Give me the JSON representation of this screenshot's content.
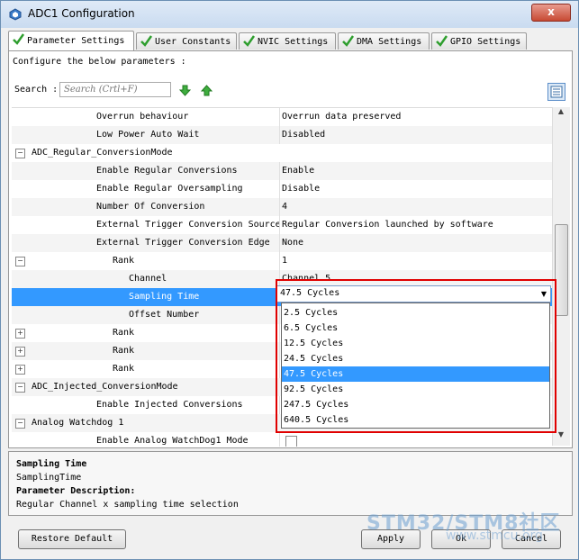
{
  "window": {
    "title": "ADC1 Configuration",
    "close_glyph": "x"
  },
  "tabs": [
    {
      "label": "Parameter Settings"
    },
    {
      "label": "User Constants"
    },
    {
      "label": "NVIC Settings"
    },
    {
      "label": "DMA Settings"
    },
    {
      "label": "GPIO Settings"
    }
  ],
  "toolbar": {
    "configure_text": "Configure the below parameters :",
    "search_label": "Search :",
    "search_placeholder": "Search (Crtl+F)"
  },
  "grid": {
    "rows": [
      {
        "key": "Overrun behaviour",
        "value": "Overrun data preserved"
      },
      {
        "key": "Low Power Auto Wait",
        "value": "Disabled"
      },
      {
        "key": "ADC_Regular_ConversionMode",
        "value": ""
      },
      {
        "key": "Enable Regular Conversions",
        "value": "Enable"
      },
      {
        "key": "Enable Regular Oversampling",
        "value": "Disable"
      },
      {
        "key": "Number Of Conversion",
        "value": "4"
      },
      {
        "key": "External Trigger Conversion Source",
        "value": "Regular Conversion launched by software"
      },
      {
        "key": "External Trigger Conversion Edge",
        "value": "None"
      },
      {
        "key": "Rank",
        "value": "1"
      },
      {
        "key": "Channel",
        "value": "Channel 5"
      },
      {
        "key": "Sampling Time",
        "value": "47.5 Cycles"
      },
      {
        "key": "Offset Number",
        "value": ""
      },
      {
        "key": "Rank",
        "value": ""
      },
      {
        "key": "Rank",
        "value": ""
      },
      {
        "key": "Rank",
        "value": ""
      },
      {
        "key": "ADC_Injected_ConversionMode",
        "value": ""
      },
      {
        "key": "Enable Injected Conversions",
        "value": ""
      },
      {
        "key": "Analog Watchdog 1",
        "value": ""
      },
      {
        "key": "Enable Analog WatchDog1 Mode",
        "value": ""
      }
    ]
  },
  "dropdown": {
    "selected": "47.5 Cycles",
    "options": [
      "2.5 Cycles",
      "6.5 Cycles",
      "12.5 Cycles",
      "24.5 Cycles",
      "47.5 Cycles",
      "92.5 Cycles",
      "247.5 Cycles",
      "640.5 Cycles"
    ]
  },
  "description": {
    "title": "Sampling Time",
    "name": "SamplingTime",
    "param_heading": "Parameter Description:",
    "text": "Regular Channel x sampling time selection"
  },
  "buttons": {
    "restore": "Restore Default",
    "apply": "Apply",
    "ok": "Ok",
    "cancel": "Cancel"
  },
  "watermark": {
    "main": "STM32/STM8社区",
    "sub": "www.stmcu.org"
  },
  "colors": {
    "selection": "#3399ff",
    "highlight_frame": "#e00000",
    "check_green": "#2e9e2e"
  }
}
